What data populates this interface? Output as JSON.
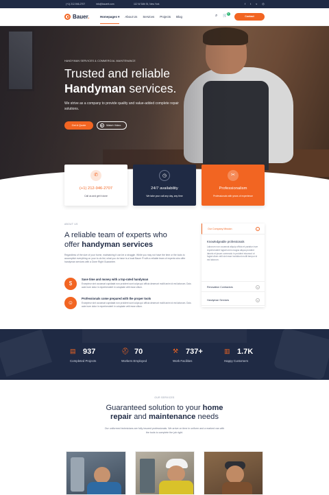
{
  "topbar": {
    "phone": "(+1) 212-946-2707",
    "email": "info@bauerit.com",
    "address": "112 W 34th St, New York",
    "social_icons": [
      "facebook-icon",
      "twitter-icon",
      "vimeo-icon",
      "instagram-icon"
    ],
    "social_glyphs": [
      "f",
      "t",
      "v",
      "◎"
    ]
  },
  "nav": {
    "logo_text": "Bauer",
    "logo_dot": ".",
    "items": [
      "Homepages ▾",
      "About Us",
      "Services",
      "Projects",
      "Blog"
    ],
    "search_glyph": "⌕",
    "cart_glyph": "🛒",
    "cart_count": "0",
    "contact_label": "Contact"
  },
  "hero": {
    "eyebrow": "HANDYMAN SERVICES & COMMERCIAL MAINTENANCE",
    "title_line1": "Trusted and reliable",
    "title_bold": "Handyman",
    "title_rest": " services.",
    "subtitle": "We strive as a company to provide quality and value-added complete repair solutions.",
    "quote_label": "Get A Quote",
    "watch_label": "Watch Video",
    "play_glyph": "▶"
  },
  "cards": [
    {
      "icon": "phone-icon",
      "glyph": "✆",
      "title": "(+1) 212-946-2707",
      "text": "Call us and get it done"
    },
    {
      "icon": "clock-icon",
      "glyph": "◷",
      "title": "24/7 availability",
      "text": "We take your call any day, any time"
    },
    {
      "icon": "tools-icon",
      "glyph": "✂",
      "title": "Professionalism",
      "text": "Professionals with years of experience"
    }
  ],
  "about": {
    "label": "ABOUT US",
    "title_line1": "A reliable team of experts who",
    "title_pre": "offer ",
    "title_bold": "handyman services",
    "text": "Regardless of the size of your home, maintaining it can be a struggle. While you may not have the time or the tools to accomplish everything on your to-do list, what you do have is a local Bauer ® with a reliable team of experts who offer handyman services with a Done Right Guarantee.",
    "features": [
      {
        "icon": "piggy-bank-icon",
        "glyph": "$",
        "title": "Save time and money with a top-rated handyman",
        "text": "Excepteur sint occaecat cupidatat non proident sunt culpa qui officia deserunt mollit anim id est laborum. Duis aute irure dolor in reprehenderit in voluptate velit esse cillum."
      },
      {
        "icon": "worker-icon",
        "glyph": "☺",
        "title": "Professionals come prepared with the proper tools",
        "text": "Excepteur sint occaecat cupidatat non proident sunt culpa qui officia deserunt mollit anim id est laborum. Duis aute irure dolor in reprehenderit in voluptate velit esse cillum."
      }
    ]
  },
  "accordion": {
    "items": [
      "Our Company Mission",
      "Renovation Contractors",
      "Handyman Services"
    ],
    "open_title": "Knowledgeable professionals",
    "open_text": "Laborum non occaecat aliquip officia et pariatur irure reprehenderit fugiat lorem magna aliqua proident laboris et ipsum commodo in proident eiusmod ut fugiat ullum velit sint esse incididunt mollit tempor id est laborum.",
    "open_glyph": "−",
    "closed_glyph": "+"
  },
  "stats": [
    {
      "icon": "folder-icon",
      "glyph": "▤",
      "value": "937",
      "label": "Completed Projects"
    },
    {
      "icon": "hardhat-icon",
      "glyph": "⛑",
      "value": "70",
      "label": "Workers Employed"
    },
    {
      "icon": "wrench-icon",
      "glyph": "⚒",
      "value": "737+",
      "label": "Work Facilities"
    },
    {
      "icon": "customers-icon",
      "glyph": "▥",
      "value": "1.7K",
      "label": "Happy Customers"
    }
  ],
  "services": {
    "label": "OUR SERVICES",
    "title_pre": "Guaranteed solution to your ",
    "title_bold1": "home repair",
    "title_mid": " and ",
    "title_bold2": "maintenance",
    "title_end": " needs",
    "text": "Our uniformed technicians are fully insured professionals. We arrive on time in uniform and a marked van with the tools to complete the job right."
  },
  "colors": {
    "accent": "#f26522",
    "navy": "#1f2a44"
  }
}
